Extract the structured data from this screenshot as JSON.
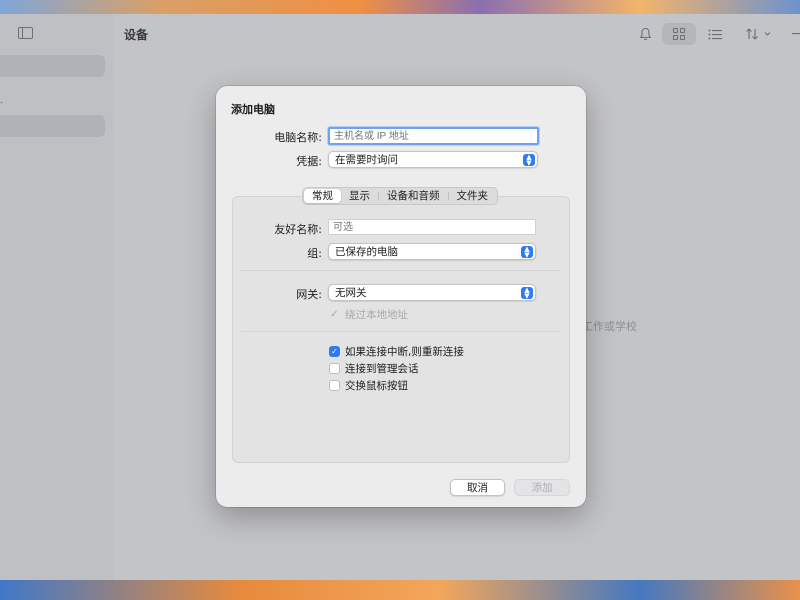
{
  "window": {
    "title": "设备",
    "empty_hint": "工作或学校"
  },
  "toolbar": {
    "bell_icon": "bell-icon",
    "grid_icon": "grid-view-icon",
    "list_icon": "list-view-icon",
    "sort_icon": "sort-icon"
  },
  "sidebar": {
    "mark": "-"
  },
  "dialog": {
    "title": "添加电脑",
    "pc_name_label": "电脑名称:",
    "pc_name_placeholder": "主机名或 IP 地址",
    "credentials_label": "凭据:",
    "credentials_value": "在需要时询问",
    "tabs": [
      "常规",
      "显示",
      "设备和音频",
      "文件夹"
    ],
    "friendly_name_label": "友好名称:",
    "friendly_name_placeholder": "可选",
    "group_label": "组:",
    "group_value": "已保存的电脑",
    "gateway_label": "网关:",
    "gateway_value": "无网关",
    "bypass_label": "绕过本地地址",
    "bypass_checked": true,
    "bypass_disabled": true,
    "options": [
      {
        "label": "如果连接中断,则重新连接",
        "checked": true
      },
      {
        "label": "连接到管理会话",
        "checked": false
      },
      {
        "label": "交换鼠标按钮",
        "checked": false
      }
    ],
    "cancel_label": "取消",
    "add_label": "添加"
  },
  "colors": {
    "accent": "#2d7cf6",
    "focus_ring": "#6fa4ea"
  }
}
